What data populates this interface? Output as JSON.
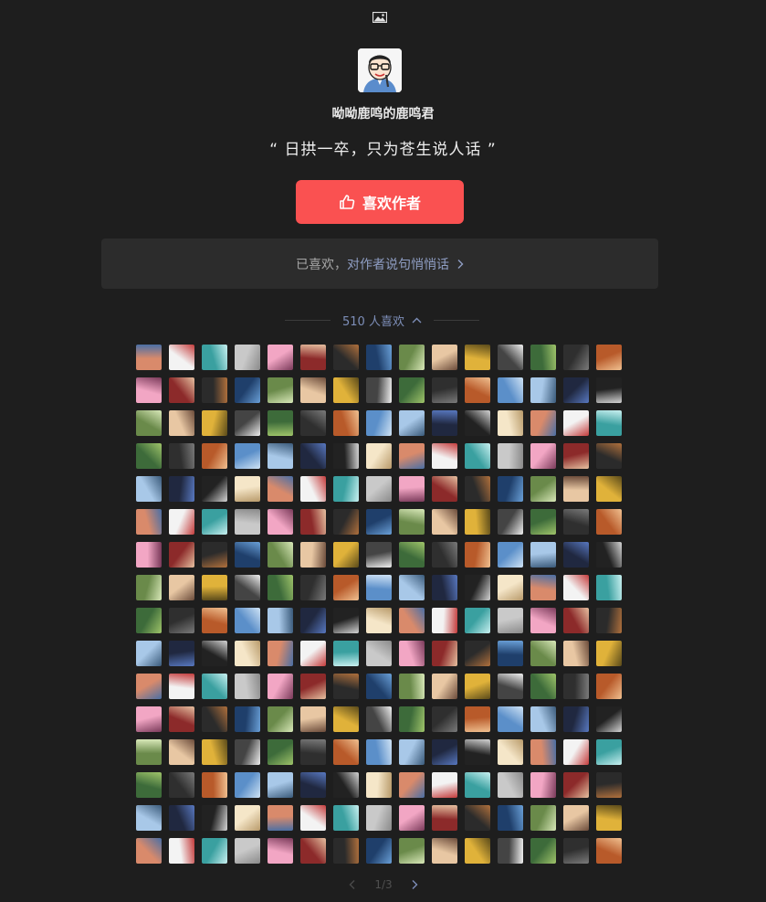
{
  "icons": {
    "top": "image-icon",
    "like": "thumbs-up-icon",
    "liked_arrow": "chevron-right-icon",
    "count_toggle": "chevron-up-icon",
    "prev": "chevron-left-icon",
    "next": "chevron-right-icon"
  },
  "colors": {
    "background": "#1e1e1e",
    "like_button": "#fa5151",
    "liked_bar": "#2c2c2c",
    "link": "#8f9ec4"
  },
  "author": {
    "name": "呦呦鹿鸣的鹿鸣君",
    "motto": "“ 日拱一卒，只为苍生说人话 ”"
  },
  "like_button": {
    "label": "喜欢作者"
  },
  "liked_bar": {
    "prefix": "已喜欢，",
    "link": "对作者说句悄悄话"
  },
  "likes": {
    "count_label": "510 人喜欢",
    "avatar_count": 240
  },
  "pagination": {
    "page_indicator": "1/3"
  }
}
